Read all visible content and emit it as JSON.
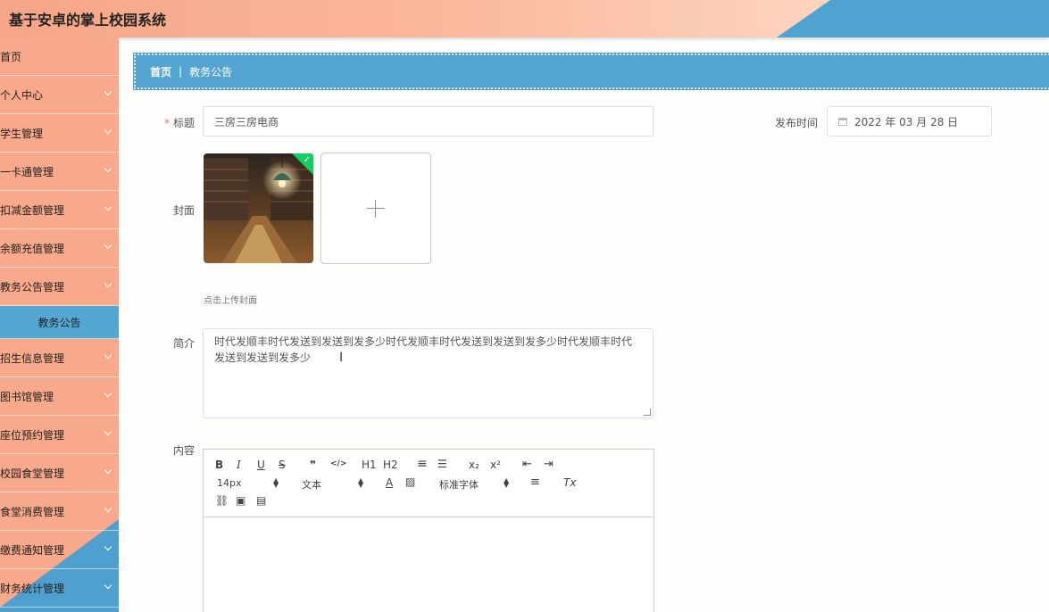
{
  "header": {
    "title": "基于安卓的掌上校园系统"
  },
  "sidebar": {
    "items": [
      {
        "label": "首页"
      },
      {
        "label": "个人中心"
      },
      {
        "label": "学生管理"
      },
      {
        "label": "一卡通管理"
      },
      {
        "label": "扣减金额管理"
      },
      {
        "label": "余额充值管理"
      },
      {
        "label": "教务公告管理"
      },
      {
        "label": "教务公告"
      },
      {
        "label": "招生信息管理"
      },
      {
        "label": "图书馆管理"
      },
      {
        "label": "座位预约管理"
      },
      {
        "label": "校园食堂管理"
      },
      {
        "label": "食堂消费管理"
      },
      {
        "label": "缴费通知管理"
      },
      {
        "label": "财务统计管理"
      }
    ]
  },
  "breadcrumb": {
    "home": "首页",
    "separator": "|",
    "current": "教务公告"
  },
  "form": {
    "title_label": "标题",
    "required_mark": "*",
    "title_value": "三房三房电商",
    "publish_time_label": "发布时间",
    "publish_time_value": "2022 年 03 月 28 日",
    "cover_label": "封面",
    "upload_hint": "点击上传封面",
    "summary_label": "简介",
    "summary_value": "时代发顺丰时代发送到发送到发多少时代发顺丰时代发送到发送到发多少时代发顺丰时代发送到发送到发多少",
    "content_label": "内容"
  },
  "editor": {
    "toolbar": {
      "bold": "B",
      "italic": "I",
      "underline": "U",
      "strike": "S",
      "quote": "❞",
      "code": "</>",
      "h1": "H1",
      "h2": "H2",
      "ordered_list": "≡",
      "bullet_list": "☰",
      "subscript": "x₂",
      "superscript": "x²",
      "outdent": "⇤",
      "indent": "⇥",
      "size": "14px",
      "paragraph": "文本",
      "font": "标准字体",
      "text_color": "A",
      "align": "≡",
      "clear_format": "Tx"
    }
  }
}
